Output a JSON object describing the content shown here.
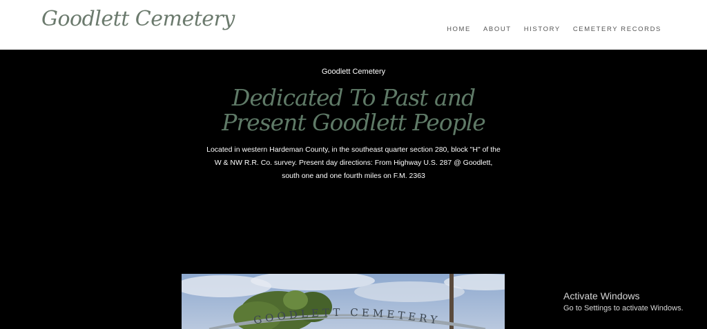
{
  "header": {
    "site_title": "Goodlett Cemetery",
    "nav": [
      "HOME",
      "ABOUT",
      "HISTORY",
      "CEMETERY RECORDS"
    ]
  },
  "hero": {
    "subtitle": "Goodlett Cemetery",
    "title_line1": "Dedicated To Past and",
    "title_line2": "Present Goodlett People",
    "description": "Located in western Hardeman County, in the southeast quarter section 280, block \"H\" of the W & NW R.R. Co. survey. Present day directions: From Highway U.S. 287 @ Goodlett, south one and one fourth miles on F.M. 2363"
  },
  "photo": {
    "arch_text": "GOODLETT CEMETERY"
  },
  "watermark": {
    "title": "Activate Windows",
    "subtitle": "Go to Settings to activate Windows."
  },
  "colors": {
    "header_bg": "#ffffff",
    "page_bg": "#000000",
    "title_green": "#5f7a67",
    "site_title": "#6b7a6d"
  }
}
